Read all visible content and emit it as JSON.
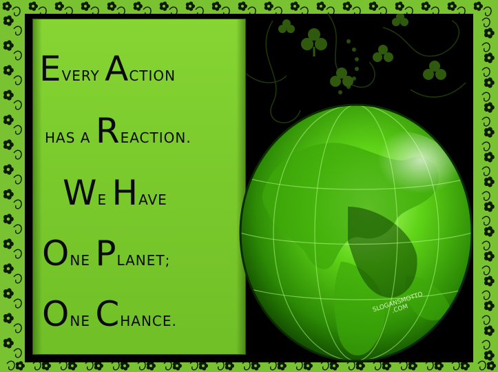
{
  "slogan": {
    "line1": {
      "cap1": "E",
      "rest1": "very ",
      "cap2": "A",
      "rest2": "ction"
    },
    "line2": {
      "pre": "has a ",
      "cap": "R",
      "post": "eaction."
    },
    "line3": {
      "cap1": "W",
      "rest1": "e ",
      "cap2": "H",
      "rest2": "ave"
    },
    "line4": {
      "cap1": "O",
      "rest1": "ne ",
      "cap2": "P",
      "rest2": "lanet;"
    },
    "line5": {
      "cap1": "O",
      "rest1": "ne ",
      "cap2": "C",
      "rest2": "hance."
    }
  },
  "watermark": {
    "line1": "SLOGANSMOTTO",
    "line2": ".COM"
  },
  "colors": {
    "frame_green": "#79c232",
    "card_green": "#7fce30",
    "globe_green": "#5ad00e",
    "text": "#0a0a0a"
  },
  "icons": [
    "globe-icon",
    "shamrock-icon",
    "flower-icon",
    "swirl-icon"
  ]
}
